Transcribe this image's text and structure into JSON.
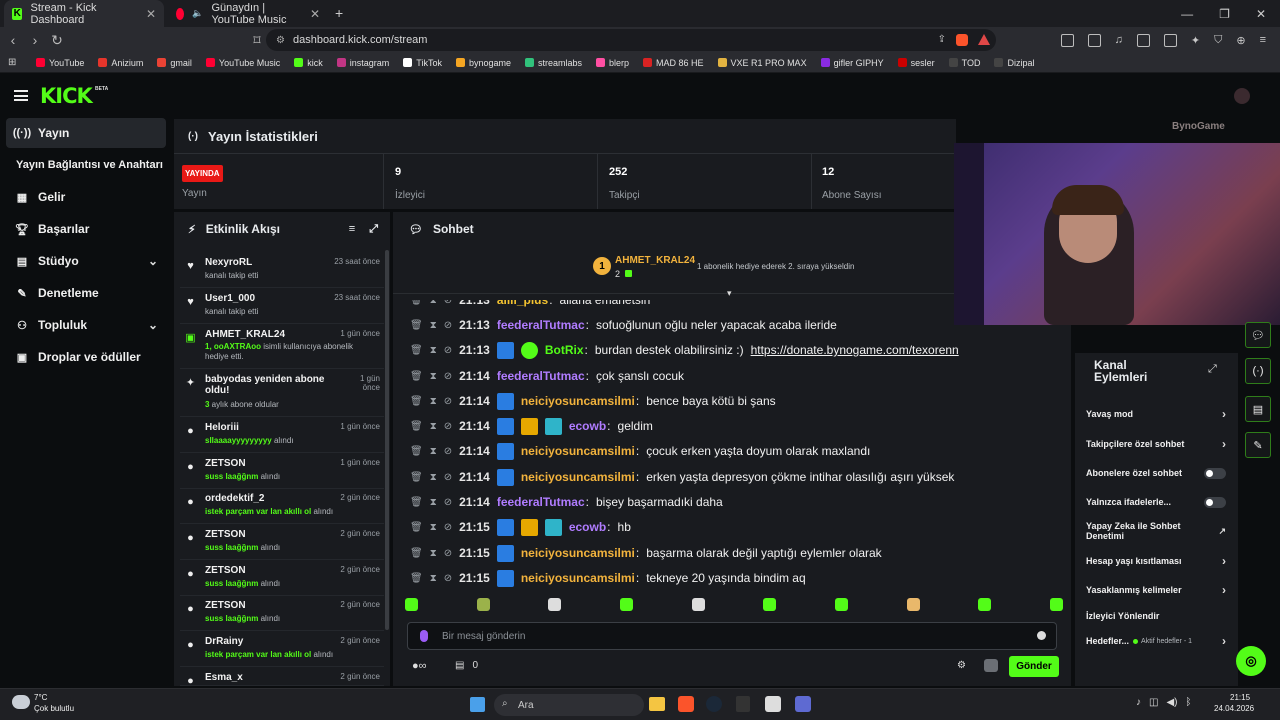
{
  "browser": {
    "tabs": [
      {
        "label": "Stream - Kick Dashboard"
      },
      {
        "label": "Günaydın | YouTube Music"
      }
    ],
    "url": "dashboard.kick.com/stream",
    "bookmarks": [
      "YouTube",
      "Anizium",
      "gmail",
      "YouTube Music",
      "kick",
      "instagram",
      "TikTok",
      "bynogame",
      "streamlabs",
      "blerp",
      "MAD 86 HE",
      "VXE R1 PRO MAX",
      "gifler GIPHY",
      "sesler",
      "TOD",
      "Dizipal"
    ]
  },
  "header": {
    "logo": "KICK",
    "beta": "BETA"
  },
  "sidebar": {
    "items": [
      {
        "label": "Yayın",
        "icon": "broadcast-icon"
      },
      {
        "label": "Yayın Bağlantısı ve Anahtarı",
        "icon": ""
      },
      {
        "label": "Gelir",
        "icon": "chart-icon"
      },
      {
        "label": "Başarılar",
        "icon": "trophy-icon"
      },
      {
        "label": "Stüdyo",
        "icon": "studio-icon"
      },
      {
        "label": "Denetleme",
        "icon": "wrench-icon"
      },
      {
        "label": "Topluluk",
        "icon": "community-icon"
      },
      {
        "label": "Droplar ve ödüller",
        "icon": "gift-icon"
      }
    ]
  },
  "stats": {
    "title": "Yayın İstatistikleri",
    "live_badge": "YAYINDA",
    "live_label": "Yayın",
    "viewers": "9",
    "viewers_label": "İzleyici",
    "followers": "252",
    "followers_label": "Takipçi",
    "subs": "12",
    "subs_label": "Abone Sayısı"
  },
  "feed": {
    "title": "Etkinlik Akışı",
    "items": [
      {
        "name": "NexyroRL",
        "time": "23 saat önce",
        "sub": "kanalı takip etti",
        "hl": ""
      },
      {
        "name": "User1_000",
        "time": "23 saat önce",
        "sub": "kanalı takip etti",
        "hl": ""
      },
      {
        "name": "AHMET_KRAL24",
        "time": "1 gün önce",
        "hl": "1, ooAXTRAoo",
        "sub": " isimli kullanıcıya abonelik hediye etti."
      },
      {
        "name": "babyodas yeniden abone oldu!",
        "time": "1 gün önce",
        "hl": "3",
        "sub": " aylık abone oldular"
      },
      {
        "name": "Heloriii",
        "time": "1 gün önce",
        "hl": "sllaaaayyyyyyyyy",
        "sub": " alındı"
      },
      {
        "name": "ZETSON",
        "time": "1 gün önce",
        "hl": "suss laağğnm",
        "sub": " alındı"
      },
      {
        "name": "ordedektif_2",
        "time": "2 gün önce",
        "hl": "istek parçam var lan akıllı ol",
        "sub": " alındı"
      },
      {
        "name": "ZETSON",
        "time": "2 gün önce",
        "hl": "suss laağğnm",
        "sub": " alındı"
      },
      {
        "name": "ZETSON",
        "time": "2 gün önce",
        "hl": "suss laağğnm",
        "sub": " alındı"
      },
      {
        "name": "ZETSON",
        "time": "2 gün önce",
        "hl": "suss laağğnm",
        "sub": " alındı"
      },
      {
        "name": "DrRainy",
        "time": "2 gün önce",
        "hl": "istek parçam var lan akıllı ol",
        "sub": " alındı"
      },
      {
        "name": "Esma_x",
        "time": "2 gün önce",
        "hl": "",
        "sub": ""
      }
    ]
  },
  "chat": {
    "title": "Sohbet",
    "pinned_user": "AHMET_KRAL24",
    "pinned_count": "2",
    "pinned_note": "1 abonelik hediye ederek 2. sıraya yükseldin",
    "messages": [
      {
        "time": "21:13",
        "user": "allli_plus",
        "color": "#f2c230",
        "msg": "allana emanetsin"
      },
      {
        "time": "21:13",
        "user": "feederalTutmac",
        "color": "#b07cff",
        "msg": "sofuoğlunun oğlu neler yapacak acaba ileride"
      },
      {
        "time": "21:13",
        "user": "BotRix",
        "color": "#53fc18",
        "msg": "burdan destek olabilirsiniz :)",
        "link": "https://donate.bynogame.com/texorenn"
      },
      {
        "time": "21:14",
        "user": "feederalTutmac",
        "color": "#b07cff",
        "msg": "çok şanslı cocuk"
      },
      {
        "time": "21:14",
        "user": "neiciyosuncamsilmi",
        "color": "#f2b33d",
        "msg": "bence baya kötü bi şans"
      },
      {
        "time": "21:14",
        "user": "ecowb",
        "color": "#b07cff",
        "msg": "geldim"
      },
      {
        "time": "21:14",
        "user": "neiciyosuncamsilmi",
        "color": "#f2b33d",
        "msg": "çocuk erken yaşta doyum olarak maxlandı"
      },
      {
        "time": "21:14",
        "user": "neiciyosuncamsilmi",
        "color": "#f2b33d",
        "msg": "erken yaşta depresyon çökme intihar olasılığı aşırı yüksek"
      },
      {
        "time": "21:14",
        "user": "feederalTutmac",
        "color": "#b07cff",
        "msg": "bişey başarmadıki daha"
      },
      {
        "time": "21:15",
        "user": "ecowb",
        "color": "#b07cff",
        "msg": "hb"
      },
      {
        "time": "21:15",
        "user": "neiciyosuncamsilmi",
        "color": "#f2b33d",
        "msg": "başarma olarak değil yaptığı eylemler olarak"
      },
      {
        "time": "21:15",
        "user": "neiciyosuncamsilmi",
        "color": "#f2b33d",
        "msg": "tekneye 20 yaşında bindim aq"
      }
    ],
    "input_placeholder": "Bir mesaj gönderin",
    "count": "0",
    "send": "Gönder"
  },
  "actions": {
    "title": "Kanal Eylemleri",
    "rows": [
      {
        "label": "Yavaş mod",
        "kind": "chev"
      },
      {
        "label": "Takipçilere özel sohbet",
        "kind": "chev"
      },
      {
        "label": "Abonelere özel sohbet",
        "kind": "toggle"
      },
      {
        "label": "Yalnızca ifadelerle...",
        "kind": "toggle"
      },
      {
        "label": "Yapay Zeka ile Sohbet Denetimi",
        "kind": "ext"
      },
      {
        "label": "Hesap yaşı kısıtlaması",
        "kind": "chev"
      },
      {
        "label": "Yasaklanmış kelimeler",
        "kind": "chev"
      },
      {
        "label": "İzleyici Yönlendir",
        "kind": "none"
      },
      {
        "label": "Hedefler...",
        "kind": "chev",
        "extra": "Aktif hedefler - 1"
      }
    ]
  },
  "overlay": {
    "text": "BynoGame"
  },
  "taskbar": {
    "temp": "7°C",
    "weather": "Çok bulutlu",
    "search": "Ara",
    "time": "21:15",
    "date": "24.04.2026"
  },
  "colors": {
    "accent": "#53fc18",
    "live": "#e91916",
    "panel": "#191b1f"
  }
}
